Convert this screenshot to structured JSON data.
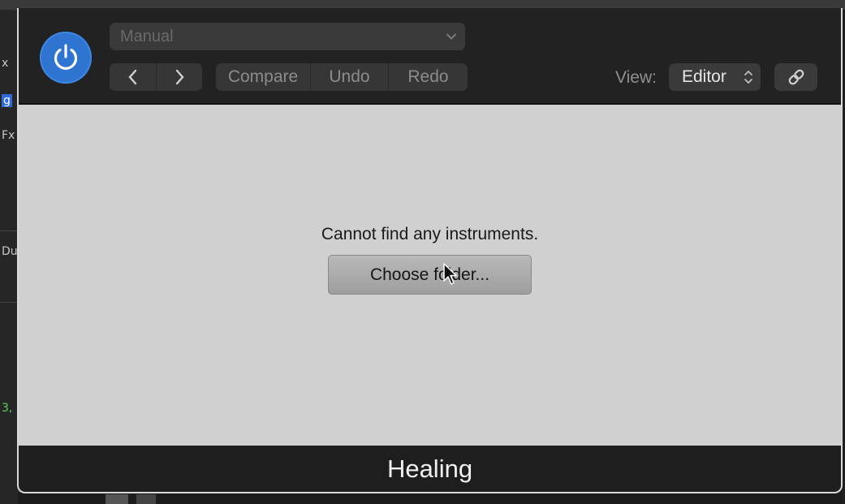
{
  "header": {
    "preset_value": "Manual",
    "compare_label": "Compare",
    "undo_label": "Undo",
    "redo_label": "Redo",
    "view_label": "View:",
    "view_value": "Editor"
  },
  "content": {
    "message": "Cannot find any instruments.",
    "choose_button_label": "Choose folder..."
  },
  "footer": {
    "plugin_name": "Healing"
  },
  "background": {
    "left_fragments": [
      "x",
      "g",
      "Fx",
      "Du",
      "3,"
    ]
  },
  "icons": {
    "power": "power-icon",
    "preset_dropdown": "chevron-down-icon",
    "prev": "chevron-left-icon",
    "next": "chevron-right-icon",
    "view_select": "up-down-chevron-icon",
    "link": "link-icon",
    "cursor": "mouse-pointer-icon"
  },
  "colors": {
    "power_accent": "#2f74d0",
    "header_bg": "#222222",
    "content_bg": "#d0d0d0",
    "footer_bg": "#1e1e1e"
  }
}
